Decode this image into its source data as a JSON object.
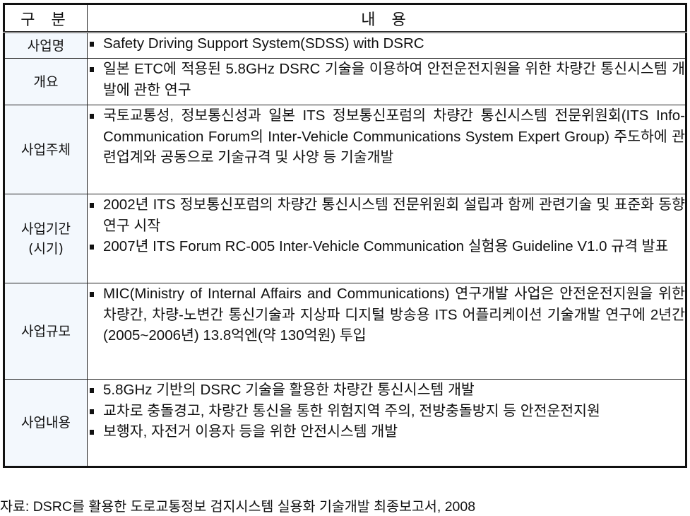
{
  "table": {
    "headers": {
      "category": "구 분",
      "content": "내 용"
    },
    "rows": [
      {
        "category": "사업명",
        "items": [
          "Safety Driving Support System(SDSS) with DSRC"
        ]
      },
      {
        "category": "개요",
        "items": [
          "일본 ETC에 적용된 5.8GHz DSRC 기술을 이용하여 안전운전지원을 위한 차량간 통신시스템 개발에 관한 연구"
        ]
      },
      {
        "category": "사업주체",
        "items": [
          "국토교통성, 정보통신성과 일본 ITS 정보통신포럼의 차량간 통신시스템 전문위원회(ITS Info-Communication Forum의 Inter-Vehicle Communications System Expert Group) 주도하에 관련업계와 공동으로 기술규격 및 사양 등 기술개발"
        ]
      },
      {
        "category": "사업기간",
        "category_sub": "(시기)",
        "items": [
          "2002년 ITS 정보통신포럼의 차량간 통신시스템 전문위원회 설립과 함께 관련기술 및 표준화 동향 연구 시작",
          "2007년 ITS Forum RC-005 Inter-Vehicle Communication 실험용 Guideline V1.0 규격 발표"
        ]
      },
      {
        "category": "사업규모",
        "items": [
          "MIC(Ministry of Internal Affairs and Communications) 연구개발 사업은 안전운전지원을 위한 차량간, 차량-노변간 통신기술과 지상파 디지털 방송용 ITS 어플리케이션 기술개발 연구에 2년간(2005~2006년) 13.8억엔(약 130억원) 투입"
        ]
      },
      {
        "category": "사업내용",
        "items": [
          "5.8GHz 기반의 DSRC 기술을 활용한 차량간 통신시스템 개발",
          "교차로 충돌경고, 차량간 통신을 통한 위험지역 주의, 전방충돌방지 등 안전운전지원",
          "보행자, 자전거 이용자 등을 위한 안전시스템 개발"
        ]
      }
    ]
  },
  "source_note": "자료: DSRC를 활용한 도로교통정보 검지시스템 실용화 기술개발 최종보고서, 2008",
  "colors": {
    "category_bg": "#f3f8fd",
    "border": "#222222"
  }
}
